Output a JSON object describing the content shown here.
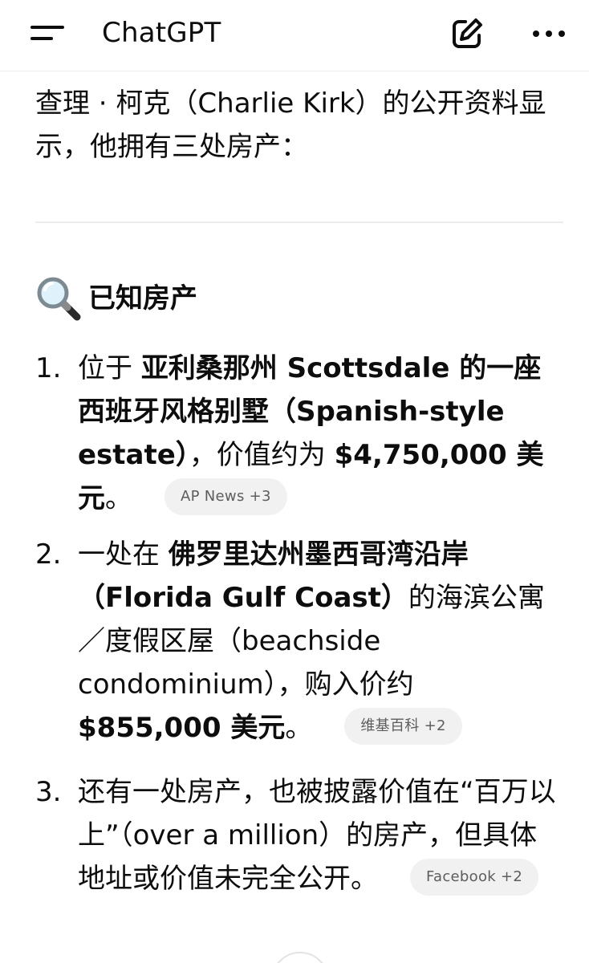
{
  "header": {
    "title": "ChatGPT",
    "menu_icon": "hamburger-menu-icon",
    "edit_icon": "new-chat-edit-icon",
    "more_icon": "more-horizontal-icon"
  },
  "intro": {
    "text": "查理 · 柯克（Charlie Kirk）的公开资料显示，他拥有三处房产："
  },
  "section": {
    "icon": "magnifying-glass-icon",
    "title": "已知房产"
  },
  "items": [
    {
      "number": "1.",
      "parts": {
        "p1": "位于 ",
        "b1": "亚利桑那州 Scottsdale 的一座西班牙风格别墅（Spanish-style estate）",
        "p2": "，价值约为 ",
        "b2": "$4,750,000 美元",
        "p3": "。"
      },
      "source": "AP News +3"
    },
    {
      "number": "2.",
      "parts": {
        "p1": "一处在 ",
        "b1": "佛罗里达州墨西哥湾沿岸（Florida Gulf Coast）",
        "p2": "的海滨公寓／度假区屋（beachside condominium），购入价约 ",
        "b2": "$855,000 美元",
        "p3": "。"
      },
      "source": "维基百科 +2"
    },
    {
      "number": "3.",
      "parts": {
        "p1": "还有一处房产，也被披露价值在“百万以上”（over a million）的房产，但具体地址或价值未完全公开",
        "p3": "。"
      },
      "source": "Facebook +2"
    }
  ]
}
